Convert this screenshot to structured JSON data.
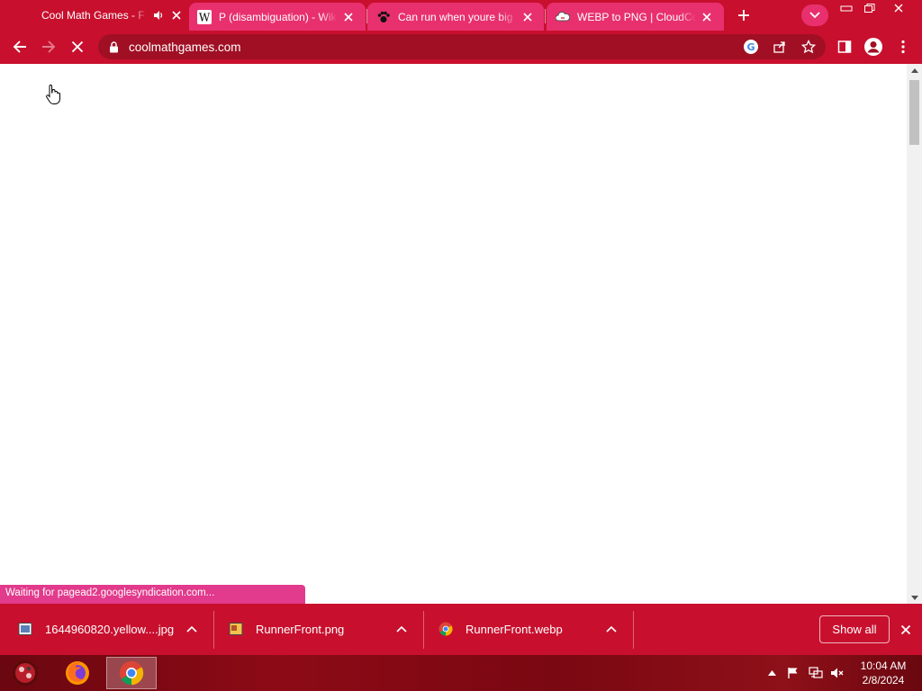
{
  "browser": {
    "tabs": [
      {
        "title": "Cool Math Games - F",
        "active": true,
        "audio": true
      },
      {
        "title": "P (disambiguation) - Wik",
        "active": false
      },
      {
        "title": "Can run when youre big !",
        "active": false
      },
      {
        "title": "WEBP to PNG | CloudCon",
        "active": false
      }
    ],
    "url": "coolmathgames.com"
  },
  "page": {
    "status_text": "Waiting for pagead2.googlesyndication.com..."
  },
  "downloads": {
    "items": [
      {
        "name": "1644960820.yellow....jpg",
        "icon": "image-file-icon"
      },
      {
        "name": "RunnerFront.png",
        "icon": "png-file-icon"
      },
      {
        "name": "RunnerFront.webp",
        "icon": "chrome-file-icon"
      }
    ],
    "show_all_label": "Show all"
  },
  "taskbar": {
    "time": "10:04 AM",
    "date": "2/8/2024"
  },
  "colors": {
    "theme": "#c8102e",
    "tab_inactive": "#e8306e",
    "omnibox": "#a00f24",
    "status_bubble": "#e23a8c"
  }
}
